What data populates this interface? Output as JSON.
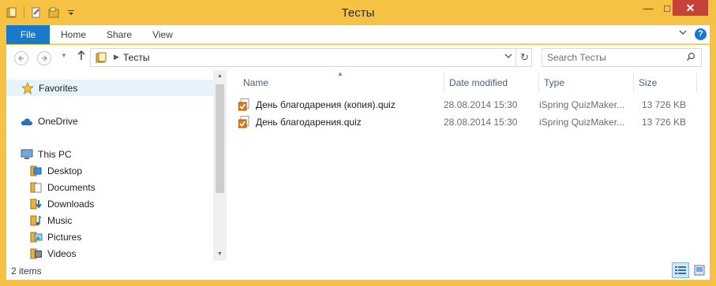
{
  "window": {
    "title": "Тесты",
    "controls": {
      "minimize": "—",
      "maximize": "□",
      "close": "✕"
    }
  },
  "ribbon": {
    "tabs": [
      "File",
      "Home",
      "Share",
      "View"
    ],
    "expand_icon": "chevron-down-icon",
    "help_label": "?"
  },
  "address": {
    "crumbs": [
      "Тесты"
    ],
    "refresh_icon": "refresh-icon"
  },
  "search": {
    "placeholder": "Search Тесты"
  },
  "nav": {
    "favorites": "Favorites",
    "onedrive": "OneDrive",
    "thispc": "This PC",
    "children": [
      "Desktop",
      "Documents",
      "Downloads",
      "Music",
      "Pictures",
      "Videos"
    ]
  },
  "filelist": {
    "columns": [
      "Name",
      "Date modified",
      "Type",
      "Size"
    ],
    "sort_column": "Name",
    "rows": [
      {
        "name": "День благодарения (копия).quiz",
        "date": "28.08.2014 15:30",
        "type": "iSpring QuizMaker...",
        "size": "13 726 KB"
      },
      {
        "name": "День благодарения.quiz",
        "date": "28.08.2014 15:30",
        "type": "iSpring QuizMaker...",
        "size": "13 726 KB"
      }
    ]
  },
  "status": {
    "count": "2 items"
  },
  "colors": {
    "frame": "#f6c244",
    "file_tab": "#1979ca",
    "close_button": "#c7403a",
    "selection": "#e5f3fb"
  }
}
